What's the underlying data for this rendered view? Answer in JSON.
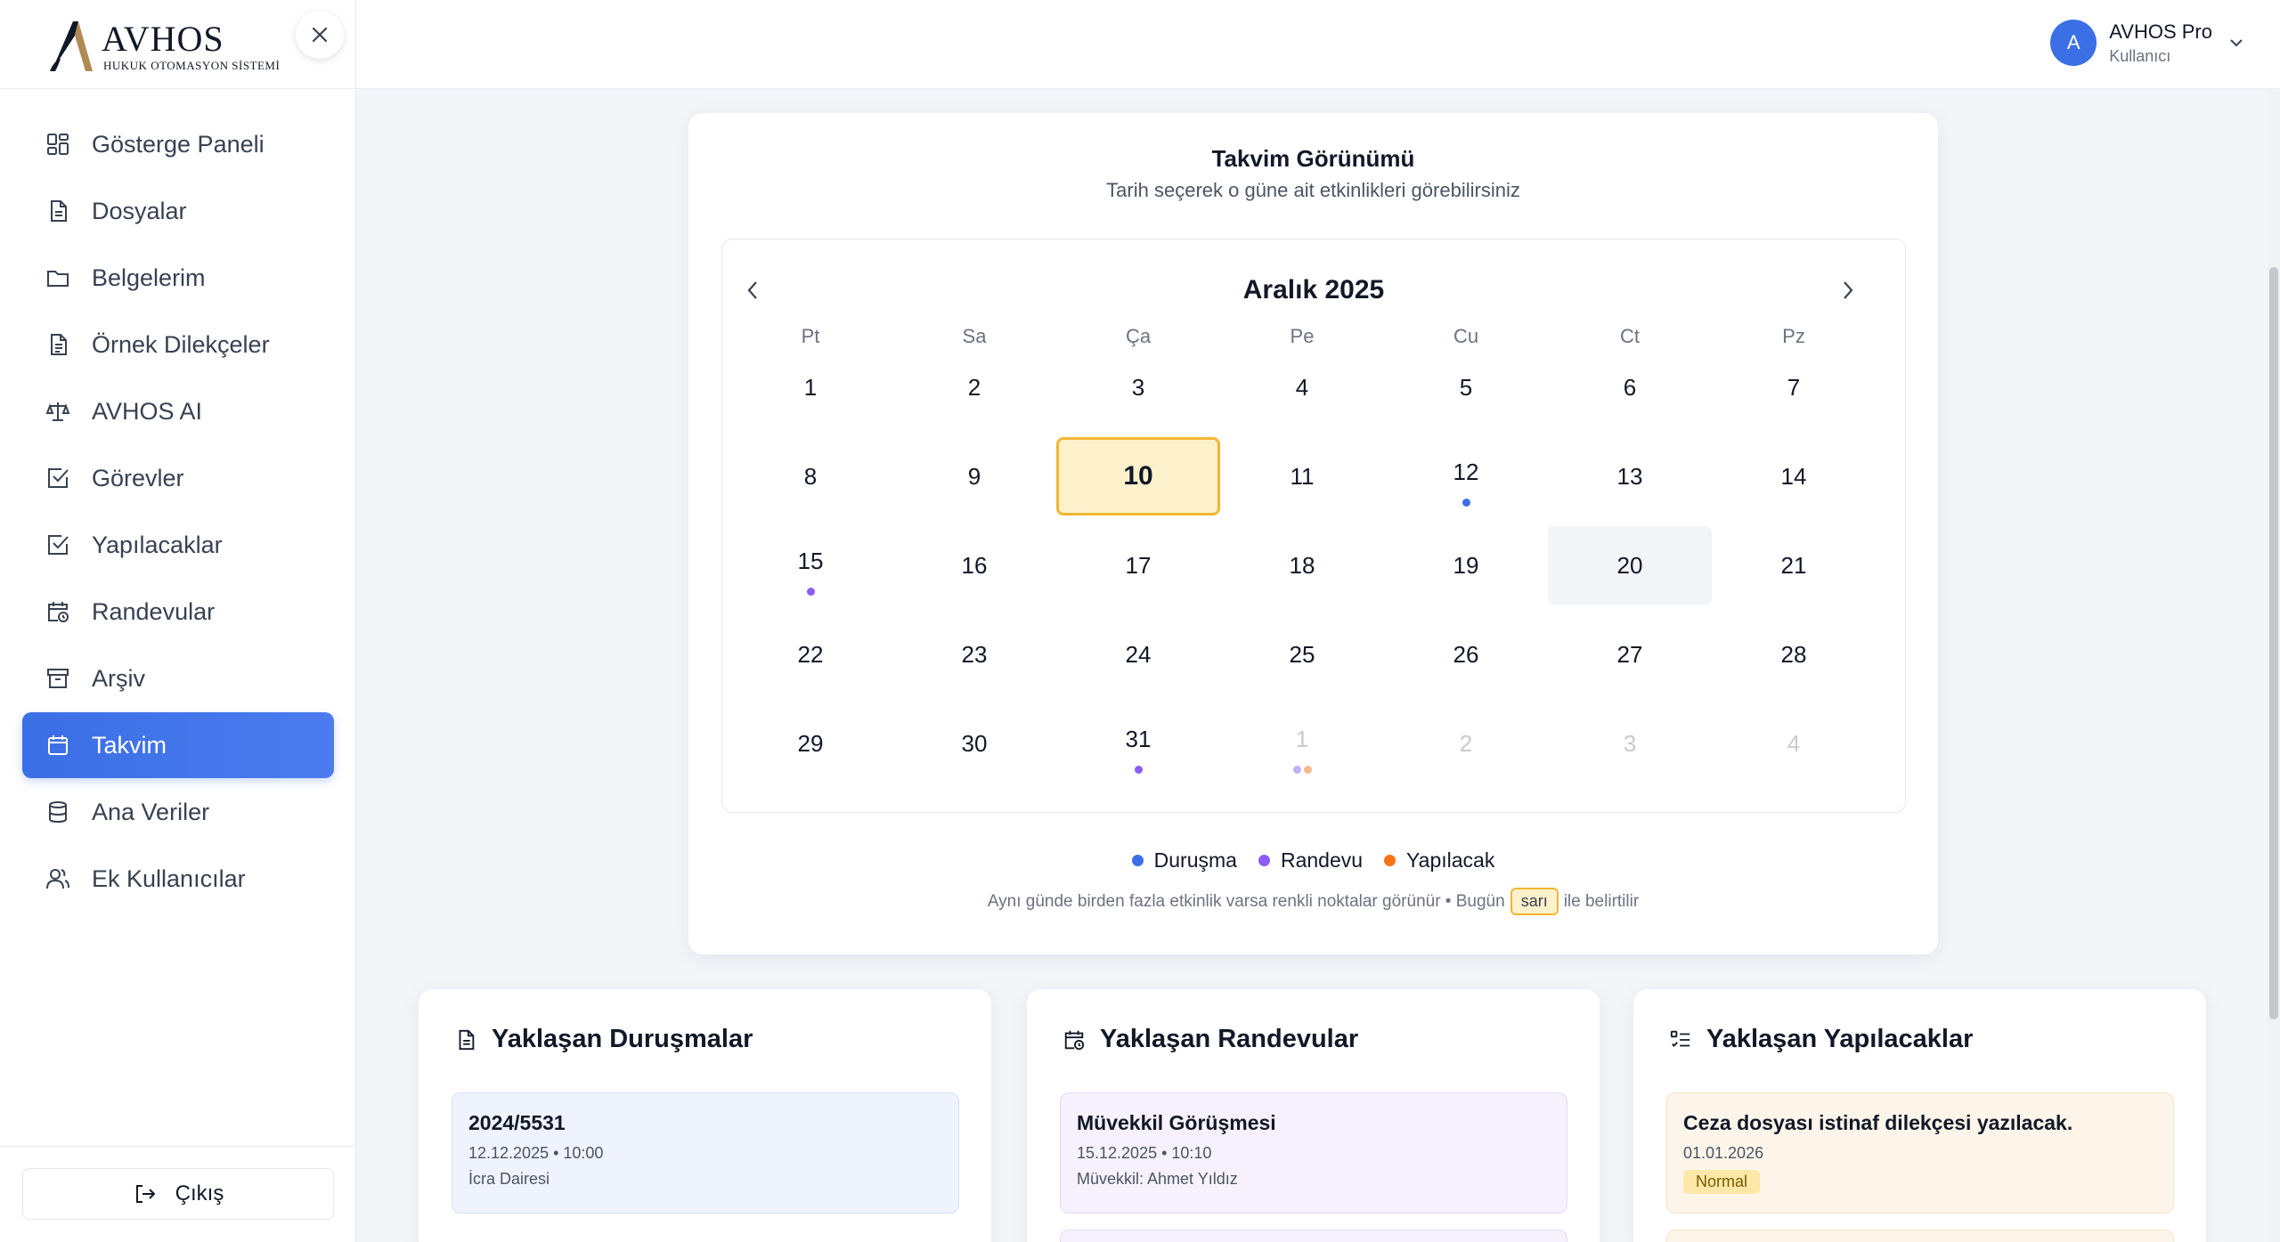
{
  "brand": {
    "title": "AVHOS",
    "subtitle": "HUKUK OTOMASYON SİSTEMİ"
  },
  "sidebar": {
    "items": [
      {
        "label": "Gösterge Paneli",
        "icon": "dashboard-icon"
      },
      {
        "label": "Dosyalar",
        "icon": "file-icon"
      },
      {
        "label": "Belgelerim",
        "icon": "folder-icon"
      },
      {
        "label": "Örnek Dilekçeler",
        "icon": "document-icon"
      },
      {
        "label": "AVHOS AI",
        "icon": "scales-icon"
      },
      {
        "label": "Görevler",
        "icon": "checkbox-icon"
      },
      {
        "label": "Yapılacaklar",
        "icon": "checkbox-icon"
      },
      {
        "label": "Randevular",
        "icon": "calendar-clock-icon"
      },
      {
        "label": "Arşiv",
        "icon": "archive-icon"
      },
      {
        "label": "Takvim",
        "icon": "calendar-icon",
        "active": true
      },
      {
        "label": "Ana Veriler",
        "icon": "database-icon"
      },
      {
        "label": "Ek Kullanıcılar",
        "icon": "users-icon"
      }
    ],
    "logout_label": "Çıkış"
  },
  "header": {
    "user_initial": "A",
    "user_name": "AVHOS Pro",
    "user_role": "Kullanıcı"
  },
  "calendar": {
    "title": "Takvim Görünümü",
    "subtitle": "Tarih seçerek o güne ait etkinlikleri görebilirsiniz",
    "month_label": "Aralık 2025",
    "weekdays": [
      "Pt",
      "Sa",
      "Ça",
      "Pe",
      "Cu",
      "Ct",
      "Pz"
    ],
    "weeks": [
      [
        {
          "d": "1"
        },
        {
          "d": "2"
        },
        {
          "d": "3"
        },
        {
          "d": "4"
        },
        {
          "d": "5"
        },
        {
          "d": "6"
        },
        {
          "d": "7"
        }
      ],
      [
        {
          "d": "8"
        },
        {
          "d": "9"
        },
        {
          "d": "10",
          "today": true
        },
        {
          "d": "11"
        },
        {
          "d": "12",
          "dots": [
            "#3b6fe6"
          ]
        },
        {
          "d": "13"
        },
        {
          "d": "14"
        }
      ],
      [
        {
          "d": "15",
          "dots": [
            "#8b5cf6"
          ]
        },
        {
          "d": "16"
        },
        {
          "d": "17"
        },
        {
          "d": "18"
        },
        {
          "d": "19"
        },
        {
          "d": "20",
          "hover": true
        },
        {
          "d": "21"
        }
      ],
      [
        {
          "d": "22"
        },
        {
          "d": "23"
        },
        {
          "d": "24"
        },
        {
          "d": "25"
        },
        {
          "d": "26"
        },
        {
          "d": "27"
        },
        {
          "d": "28"
        }
      ],
      [
        {
          "d": "29"
        },
        {
          "d": "30"
        },
        {
          "d": "31",
          "dots": [
            "#8b5cf6"
          ]
        },
        {
          "d": "1",
          "muted": true,
          "dots": [
            "#c4b0f5",
            "#f6b98a"
          ]
        },
        {
          "d": "2",
          "muted": true
        },
        {
          "d": "3",
          "muted": true
        },
        {
          "d": "4",
          "muted": true
        }
      ]
    ],
    "legend": [
      {
        "label": "Duruşma",
        "color": "#3b6fe6"
      },
      {
        "label": "Randevu",
        "color": "#8b5cf6"
      },
      {
        "label": "Yapılacak",
        "color": "#f97316"
      }
    ],
    "note_before": "Aynı günde birden fazla etkinlik varsa renkli noktalar görünür • Bugün",
    "note_badge": "sarı",
    "note_after": "ile belirtilir"
  },
  "upcoming": {
    "hearings": {
      "title": "Yaklaşan Duruşmalar",
      "item_title": "2024/5531",
      "item_date": "12.12.2025 • 10:00",
      "item_detail": "İcra Dairesi"
    },
    "appointments": {
      "title": "Yaklaşan Randevular",
      "item_title": "Müvekkil Görüşmesi",
      "item_date": "15.12.2025 • 10:10",
      "item_detail": "Müvekkil: Ahmet Yıldız"
    },
    "todos": {
      "title": "Yaklaşan Yapılacaklar",
      "item_title": "Ceza dosyası istinaf dilekçesi yazılacak.",
      "item_date": "01.01.2026",
      "item_tag": "Normal"
    }
  }
}
